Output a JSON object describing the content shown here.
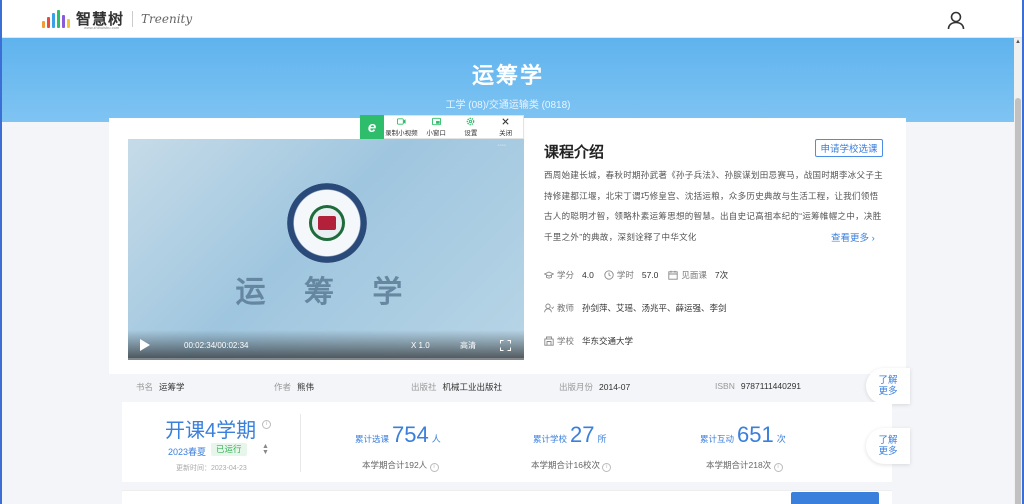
{
  "header": {
    "logo_text": "智慧树",
    "logo_sub": "www.zhihuishu.com",
    "logo_english": "Treenity"
  },
  "hero": {
    "title": "运筹学",
    "subtitle": "工学 (08)/交通运输类 (0818)"
  },
  "video_toolbar": {
    "items": [
      {
        "label": "录制小视频",
        "icon": "record-icon"
      },
      {
        "label": "小窗口",
        "icon": "mini-window-icon"
      },
      {
        "label": "设置",
        "icon": "gear-icon"
      },
      {
        "label": "关闭",
        "icon": "close-icon"
      }
    ]
  },
  "video": {
    "title_text": "运 筹 学",
    "time": "00:02:34/00:02:34",
    "speed": "X 1.0",
    "quality": "高清"
  },
  "intro": {
    "title": "课程介绍",
    "apply_label": "申请学校选课",
    "text": "西周始建长城，春秋时期孙武著《孙子兵法》、孙膑谋划田忌赛马，战国时期李冰父子主持修建都江堰，北宋丁谓巧修皇宫、沈括运粮，众多历史典故与生活工程，让我们领悟古人的聪明才智，领略朴素运筹思想的智慧。出自史记高祖本纪的“运筹帷幄之中，决胜千里之外”的典故，深刻诠释了中华文化",
    "more_label": "查看更多",
    "credit_label": "学分",
    "credit_value": "4.0",
    "hours_label": "学时",
    "hours_value": "57.0",
    "meet_label": "见面课",
    "meet_value": "7次",
    "teacher_label": "教师",
    "teachers": "孙剑萍、艾瑶、汤兆平、薛运强、李剑",
    "school_label": "学校",
    "school": "华东交通大学"
  },
  "book": {
    "name_label": "书名",
    "name": "运筹学",
    "author_label": "作者",
    "author": "熊伟",
    "publisher_label": "出版社",
    "publisher": "机械工业出版社",
    "date_label": "出版月份",
    "date": "2014-07",
    "isbn_label": "ISBN",
    "isbn": "9787111440291"
  },
  "side_more_label_1": "了解",
  "side_more_label_2": "更多",
  "stats": {
    "semester_title": "开课4学期",
    "term": "2023春夏",
    "term_status": "已运行",
    "update_label": "更新时间：",
    "update_date": "2023-04-23",
    "enroll_label": "累计选课",
    "enroll_value": "754",
    "enroll_unit": "人",
    "enroll_sub": "本学期合计192人",
    "school_label": "累计学校",
    "school_value": "27",
    "school_unit": "所",
    "school_sub": "本学期合计16校次",
    "interact_label": "累计互动",
    "interact_value": "651",
    "interact_unit": "次",
    "interact_sub": "本学期合计218次"
  },
  "colors": {
    "accent": "#3a7fdc",
    "hero": "#6cbaf0",
    "brand_green": "#2ebd6a"
  }
}
